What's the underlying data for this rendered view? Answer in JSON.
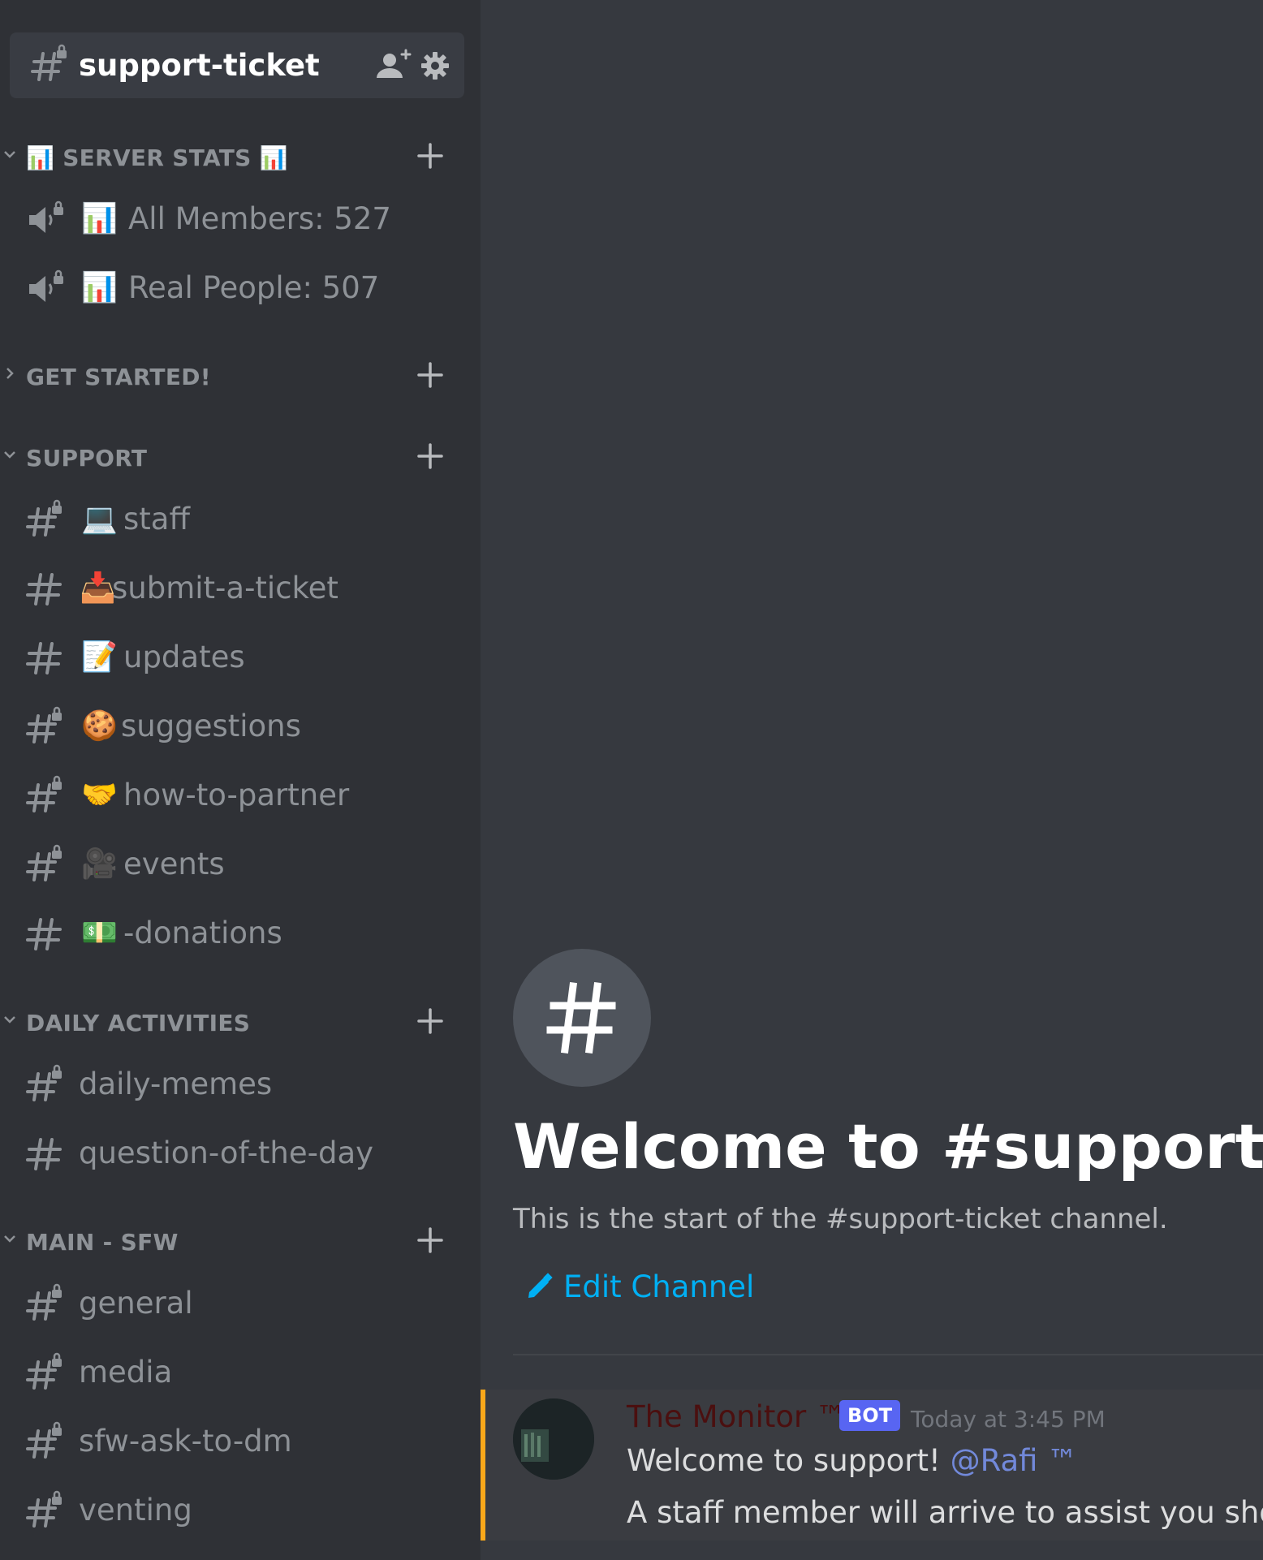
{
  "active_channel": {
    "name": "support-ticket"
  },
  "categories": [
    {
      "name": "📊 SERVER STATS 📊",
      "collapsed": false,
      "channels": [
        {
          "icon": "voice-locked-icon",
          "emoji": "📊",
          "label": "All Members: 527"
        },
        {
          "icon": "voice-locked-icon",
          "emoji": "📊",
          "label": "Real People: 507"
        }
      ]
    },
    {
      "name": "GET STARTED!",
      "collapsed": true,
      "channels": []
    },
    {
      "name": "SUPPORT",
      "collapsed": false,
      "channels": [
        {
          "icon": "hash-locked-icon",
          "emoji": "💻",
          "label": "staff"
        },
        {
          "icon": "hash-icon",
          "emoji": "📥",
          "label": "submit-a-ticket"
        },
        {
          "icon": "hash-icon",
          "emoji": "📝",
          "label": "updates"
        },
        {
          "icon": "hash-locked-icon",
          "emoji": "🍪",
          "label": "suggestions"
        },
        {
          "icon": "hash-locked-icon",
          "emoji": "🤝",
          "label": "how-to-partner"
        },
        {
          "icon": "hash-locked-icon",
          "emoji": "🎥",
          "label": "events"
        },
        {
          "icon": "hash-icon",
          "emoji": "💵",
          "label": "-donations"
        }
      ]
    },
    {
      "name": "DAILY ACTIVITIES",
      "collapsed": false,
      "channels": [
        {
          "icon": "hash-locked-icon",
          "emoji": "",
          "label": "daily-memes"
        },
        {
          "icon": "hash-icon",
          "emoji": "",
          "label": "question-of-the-day"
        }
      ]
    },
    {
      "name": "MAIN - SFW",
      "collapsed": false,
      "channels": [
        {
          "icon": "hash-locked-icon",
          "emoji": "",
          "label": "general"
        },
        {
          "icon": "hash-locked-icon",
          "emoji": "",
          "label": "media"
        },
        {
          "icon": "hash-locked-icon",
          "emoji": "",
          "label": "sfw-ask-to-dm"
        },
        {
          "icon": "hash-locked-icon",
          "emoji": "",
          "label": "venting"
        }
      ]
    }
  ],
  "main": {
    "welcome_title": "Welcome to #support-ticket!",
    "welcome_subtitle": "This is the start of the #support-ticket channel.",
    "edit_channel_label": "Edit Channel"
  },
  "message": {
    "author": "The Monitor ™",
    "badge": "BOT",
    "timestamp": "Today at 3:45 PM",
    "line1_text": "Welcome to support! ",
    "mention": "@Rafi ™",
    "line2_text": "A staff member will arrive to assist you shortly."
  },
  "colors": {
    "sidebar_bg": "#2f3136",
    "main_bg": "#36393f",
    "link_blue": "#00b0f4",
    "mention": "#7289da",
    "bot_badge": "#5865f2",
    "highlight_bar": "#faa81a"
  }
}
